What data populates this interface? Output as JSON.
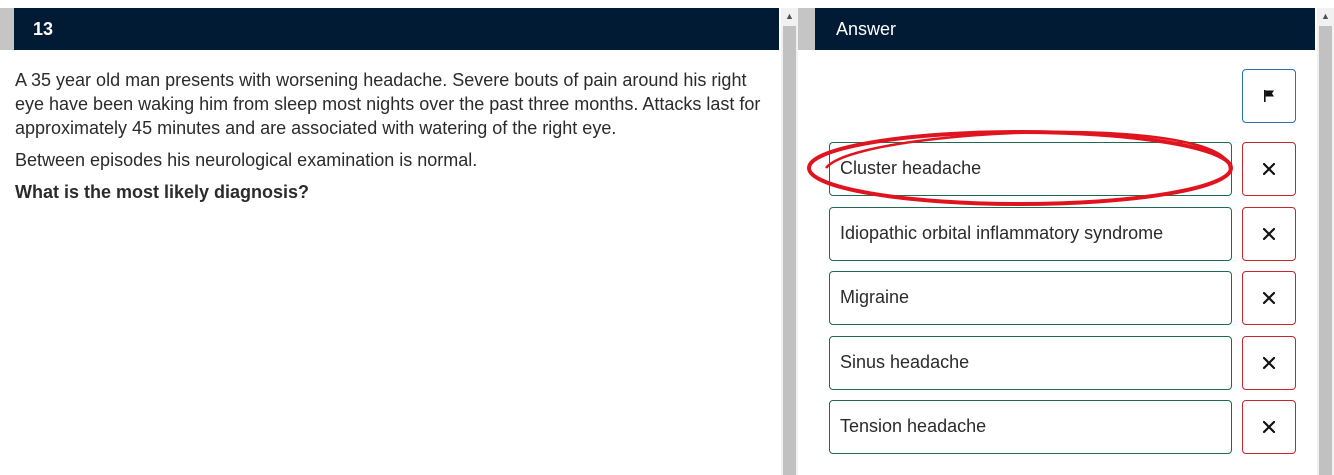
{
  "question": {
    "number": "13",
    "paragraphs": [
      "A 35 year old man presents with worsening headache. Severe bouts of pain around his right eye have been waking him from sleep most nights over the past three months. Attacks last for approximately 45 minutes and are associated with watering of the right eye.",
      "Between episodes his neurological examination is normal."
    ],
    "prompt": "What is the most likely diagnosis?"
  },
  "answer": {
    "header": "Answer",
    "flag_icon": "flag-icon",
    "exclude_icon": "close-icon",
    "options": [
      {
        "label": "Cluster headache",
        "circled": true
      },
      {
        "label": "Idiopathic orbital inflammatory syndrome",
        "circled": false
      },
      {
        "label": "Migraine",
        "circled": false
      },
      {
        "label": "Sinus headache",
        "circled": false
      },
      {
        "label": "Tension headache",
        "circled": false
      }
    ]
  },
  "colors": {
    "header_bg": "#001b33",
    "option_border": "#1e6b52",
    "exclude_border": "#c0272d",
    "flag_border": "#2a72a8",
    "highlight": "#e0141e"
  }
}
